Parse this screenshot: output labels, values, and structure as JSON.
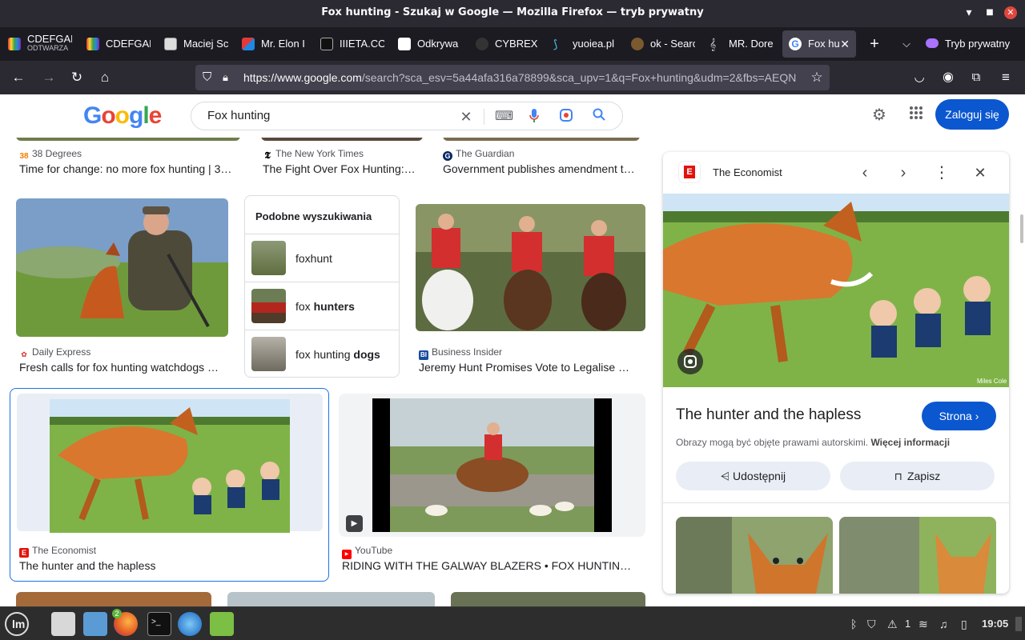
{
  "window": {
    "title": "Fox hunting - Szukaj w Google — Mozilla Firefox — tryb prywatny"
  },
  "tabs": [
    {
      "label": "CDEFGAH",
      "sub": "ODTWARZA"
    },
    {
      "label": "CDEFGAH"
    },
    {
      "label": "Maciej Sc"
    },
    {
      "label": "Mr. Elon I"
    },
    {
      "label": "IIIETA.CO"
    },
    {
      "label": "Odkrywa"
    },
    {
      "label": "CYBREX"
    },
    {
      "label": "yuoiea.pl"
    },
    {
      "label": "ok - Searc"
    },
    {
      "label": "MR. Dore"
    },
    {
      "label": "Fox hu"
    }
  ],
  "private_label": "Tryb prywatny",
  "url": {
    "host": "https://www.google.com",
    "rest": "/search?sca_esv=5a44afa316a78899&sca_upv=1&q=Fox+hunting&udm=2&fbs=AEQN"
  },
  "google": {
    "logo": "Google",
    "query": "Fox hunting",
    "login": "Zaloguj się"
  },
  "results": [
    {
      "source": "38 Degrees",
      "title": "Time for change: no more fox hunting | 3…"
    },
    {
      "source": "The New York Times",
      "title": "The Fight Over Fox Hunting:…"
    },
    {
      "source": "The Guardian",
      "title": "Government publishes amendment t…"
    },
    {
      "source": "Daily Express",
      "title": "Fresh calls for fox hunting watchdogs …"
    },
    {
      "source": "Business Insider",
      "title": "Jeremy Hunt Promises Vote to Legalise …"
    },
    {
      "source": "The Economist",
      "title": "The hunter and the hapless"
    },
    {
      "source": "YouTube",
      "title": "RIDING WITH THE GALWAY BLAZERS • FOX HUNTIN…"
    }
  ],
  "related": {
    "heading": "Podobne wyszukiwania",
    "items": [
      {
        "plain": "foxhunt",
        "bold": ""
      },
      {
        "plain": "fox ",
        "bold": "hunters"
      },
      {
        "plain": "fox hunting ",
        "bold": "dogs"
      }
    ]
  },
  "panel": {
    "source": "The Economist",
    "title": "The hunter and the hapless",
    "visit": "Strona",
    "copyright": "Obrazy mogą być objęte prawami autorskimi.",
    "more_info": "Więcej informacji",
    "share": "Udostępnij",
    "save": "Zapisz",
    "signature": "Miles Cole"
  },
  "taskbar": {
    "badge": "2",
    "tray_count": "1",
    "clock": "19:05"
  }
}
